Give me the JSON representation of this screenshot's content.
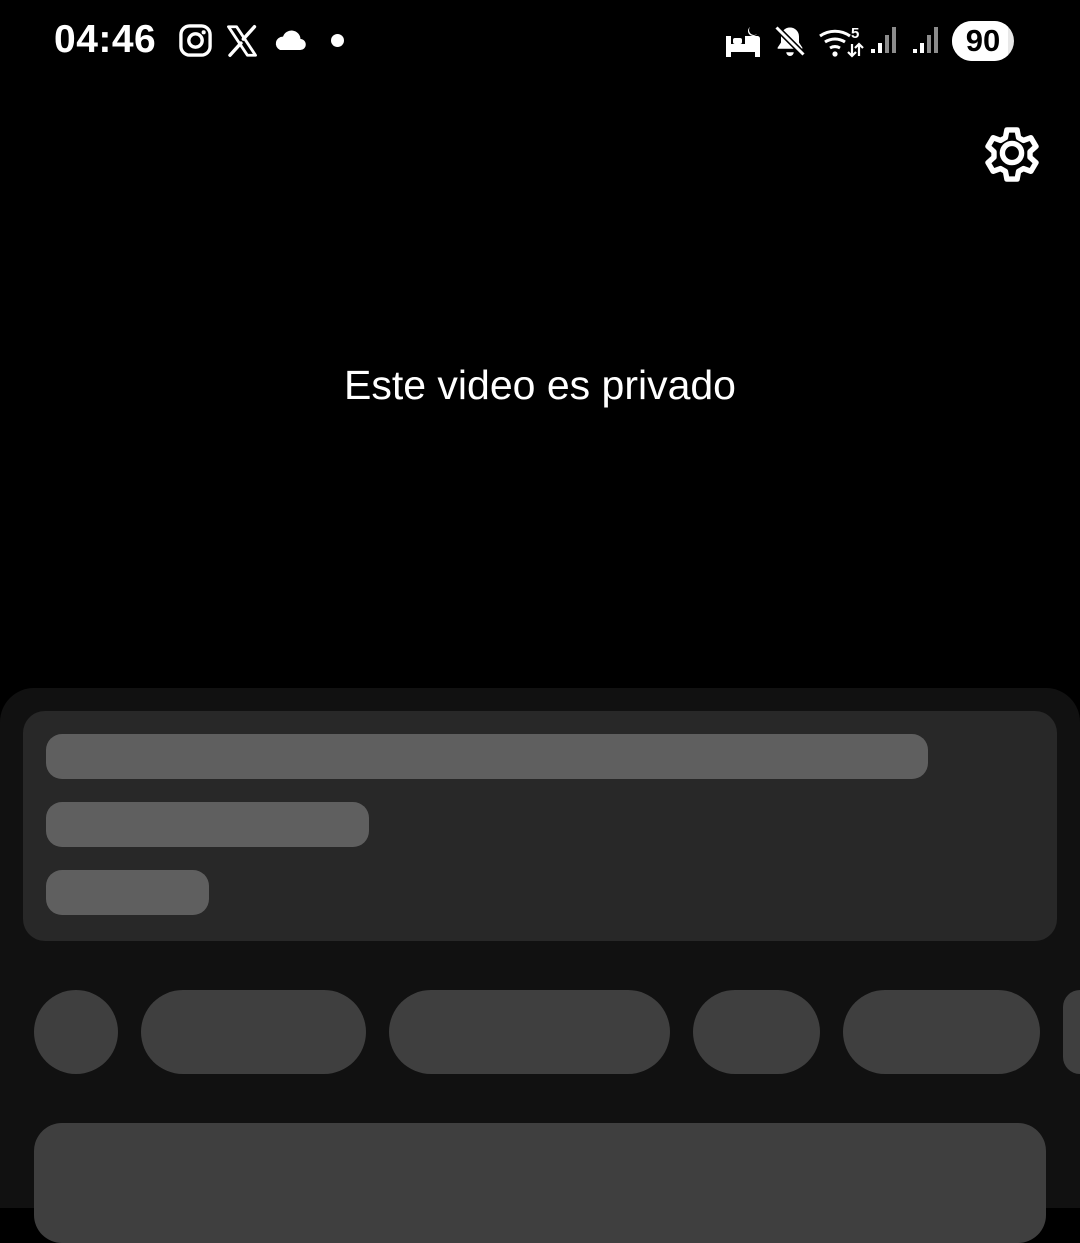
{
  "status_bar": {
    "time": "04:46",
    "notification_icons": [
      "instagram-icon",
      "x-icon",
      "cloud-icon",
      "dot-icon"
    ],
    "system_icons": [
      "bed-icon",
      "mute-icon",
      "wifi-icon",
      "signal-icon",
      "signal-icon"
    ],
    "wifi_label": "5",
    "battery_percent": "90",
    "battery_level": 0.9
  },
  "video": {
    "message": "Este video es privado",
    "settings_icon": "gear-icon"
  },
  "colors": {
    "background": "#000000",
    "sheet": "#111111",
    "card": "#282828",
    "skeleton_line": "#5f5f5f",
    "skeleton_chip": "#3f3f3f"
  }
}
